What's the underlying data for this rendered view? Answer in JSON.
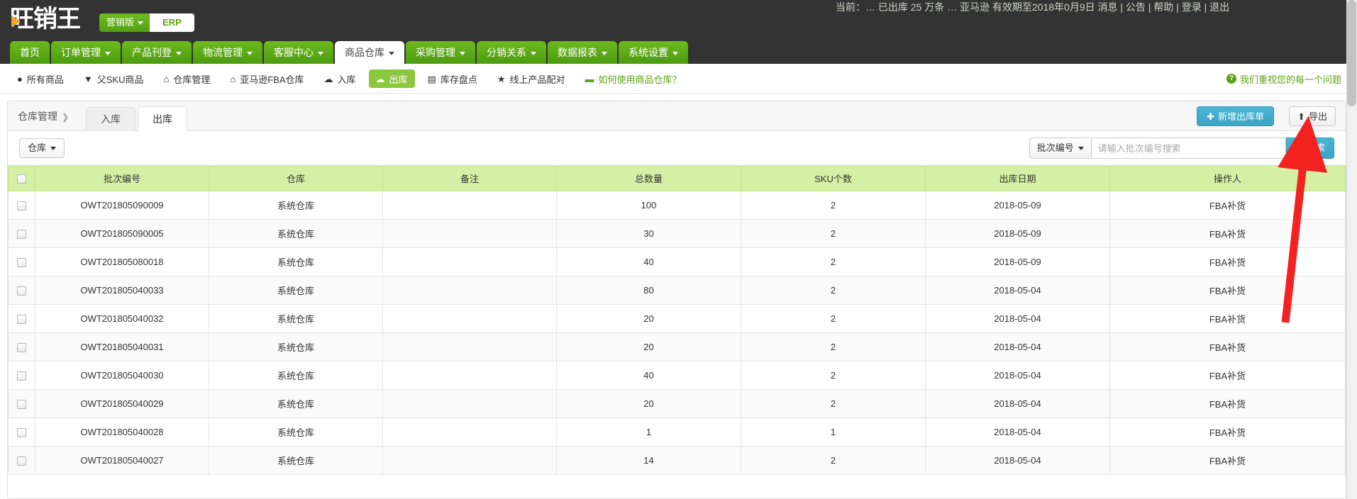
{
  "topbar": {
    "strip_text": "当前：…   已出库 25 万条   …   亚马逊 有效期至2018年0月9日   消息 | 公告 | 帮助 | 登录 | 退出",
    "logo_text": "旺销王",
    "edition_label": "营销版",
    "erp_label": "ERP"
  },
  "mainnav": {
    "items": [
      {
        "label": "首页",
        "caret": false,
        "active": false
      },
      {
        "label": "订单管理",
        "caret": true,
        "active": false
      },
      {
        "label": "产品刊登",
        "caret": true,
        "active": false
      },
      {
        "label": "物流管理",
        "caret": true,
        "active": false
      },
      {
        "label": "客服中心",
        "caret": true,
        "active": false
      },
      {
        "label": "商品仓库",
        "caret": true,
        "active": true
      },
      {
        "label": "采购管理",
        "caret": true,
        "active": false
      },
      {
        "label": "分销关系",
        "caret": true,
        "active": false
      },
      {
        "label": "数据报表",
        "caret": true,
        "active": false
      },
      {
        "label": "系统设置",
        "caret": true,
        "active": false
      }
    ]
  },
  "subnav": {
    "items": [
      {
        "label": "所有商品",
        "icon": "●",
        "icon_name": "circle-icon",
        "active": false
      },
      {
        "label": "父SKU商品",
        "icon": "▼",
        "icon_name": "filter-icon",
        "active": false
      },
      {
        "label": "仓库管理",
        "icon": "⌂",
        "icon_name": "home-icon",
        "active": false
      },
      {
        "label": "亚马逊FBA仓库",
        "icon": "⌂",
        "icon_name": "home-icon",
        "active": false
      },
      {
        "label": "入库",
        "icon": "☁",
        "icon_name": "cloud-download-icon",
        "active": false
      },
      {
        "label": "出库",
        "icon": "☁",
        "icon_name": "cloud-upload-icon",
        "active": true
      },
      {
        "label": "库存盘点",
        "icon": "▤",
        "icon_name": "list-icon",
        "active": false
      },
      {
        "label": "线上产品配对",
        "icon": "★",
        "icon_name": "star-icon",
        "active": false
      },
      {
        "label": "如何使用商品仓库？",
        "icon": "▬",
        "icon_name": "video-icon",
        "active": false
      }
    ],
    "right_notice": "我们重视您的每一个问题",
    "right_notice_icon": "?"
  },
  "panel": {
    "breadcrumb": "仓库管理",
    "breadcrumb_chevron": "❯",
    "tabs": [
      {
        "label": "入库",
        "active": false
      },
      {
        "label": "出库",
        "active": true
      }
    ],
    "new_button": "新增出库单",
    "new_button_icon": "✚",
    "export_button": "导出",
    "export_button_icon": "⬆",
    "warehouse_filter": "仓库",
    "search": {
      "dropdown_label": "批次编号",
      "placeholder": "请输入批次编号搜索",
      "value": "",
      "button_label": "搜索",
      "button_icon": "🔍"
    }
  },
  "table": {
    "columns": [
      "",
      "批次编号",
      "仓库",
      "备注",
      "总数量",
      "SKU个数",
      "出库日期",
      "操作人"
    ],
    "rows": [
      {
        "batch": "OWT201805090009",
        "warehouse": "系统仓库",
        "note": "",
        "total": "100",
        "sku": "2",
        "date": "2018-05-09",
        "operator": "FBA补货"
      },
      {
        "batch": "OWT201805090005",
        "warehouse": "系统仓库",
        "note": "",
        "total": "30",
        "sku": "2",
        "date": "2018-05-09",
        "operator": "FBA补货"
      },
      {
        "batch": "OWT201805080018",
        "warehouse": "系统仓库",
        "note": "",
        "total": "40",
        "sku": "2",
        "date": "2018-05-09",
        "operator": "FBA补货"
      },
      {
        "batch": "OWT201805040033",
        "warehouse": "系统仓库",
        "note": "",
        "total": "80",
        "sku": "2",
        "date": "2018-05-04",
        "operator": "FBA补货"
      },
      {
        "batch": "OWT201805040032",
        "warehouse": "系统仓库",
        "note": "",
        "total": "20",
        "sku": "2",
        "date": "2018-05-04",
        "operator": "FBA补货"
      },
      {
        "batch": "OWT201805040031",
        "warehouse": "系统仓库",
        "note": "",
        "total": "20",
        "sku": "2",
        "date": "2018-05-04",
        "operator": "FBA补货"
      },
      {
        "batch": "OWT201805040030",
        "warehouse": "系统仓库",
        "note": "",
        "total": "40",
        "sku": "2",
        "date": "2018-05-04",
        "operator": "FBA补货"
      },
      {
        "batch": "OWT201805040029",
        "warehouse": "系统仓库",
        "note": "",
        "total": "20",
        "sku": "2",
        "date": "2018-05-04",
        "operator": "FBA补货"
      },
      {
        "batch": "OWT201805040028",
        "warehouse": "系统仓库",
        "note": "",
        "total": "1",
        "sku": "1",
        "date": "2018-05-04",
        "operator": "FBA补货"
      },
      {
        "batch": "OWT201805040027",
        "warehouse": "系统仓库",
        "note": "",
        "total": "14",
        "sku": "2",
        "date": "2018-05-04",
        "operator": "FBA补货"
      }
    ]
  },
  "annotation": {
    "arrow_color": "#f42121"
  }
}
